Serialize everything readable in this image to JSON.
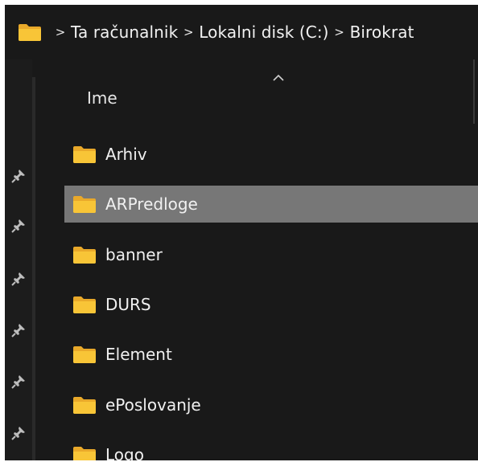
{
  "breadcrumb": {
    "items": [
      "Ta računalnik",
      "Lokalni disk (C:)",
      "Birokrat"
    ],
    "separator": ">"
  },
  "file_list": {
    "column_header": "Ime",
    "selected_index": 1,
    "items": [
      {
        "name": "Arhiv"
      },
      {
        "name": "ARPredloge"
      },
      {
        "name": "banner"
      },
      {
        "name": "DURS"
      },
      {
        "name": "Element"
      },
      {
        "name": "ePoslovanje"
      },
      {
        "name": "Logo"
      }
    ]
  },
  "colors": {
    "background": "#191919",
    "selected_row": "#777777",
    "folder_yellow": "#f8c537",
    "text": "#f0f0f0"
  },
  "icons": {
    "breadcrumb_root": "folder-icon",
    "row_item": "folder-icon",
    "sidebar": "pin-icon",
    "sort": "sort-ascending-icon"
  }
}
